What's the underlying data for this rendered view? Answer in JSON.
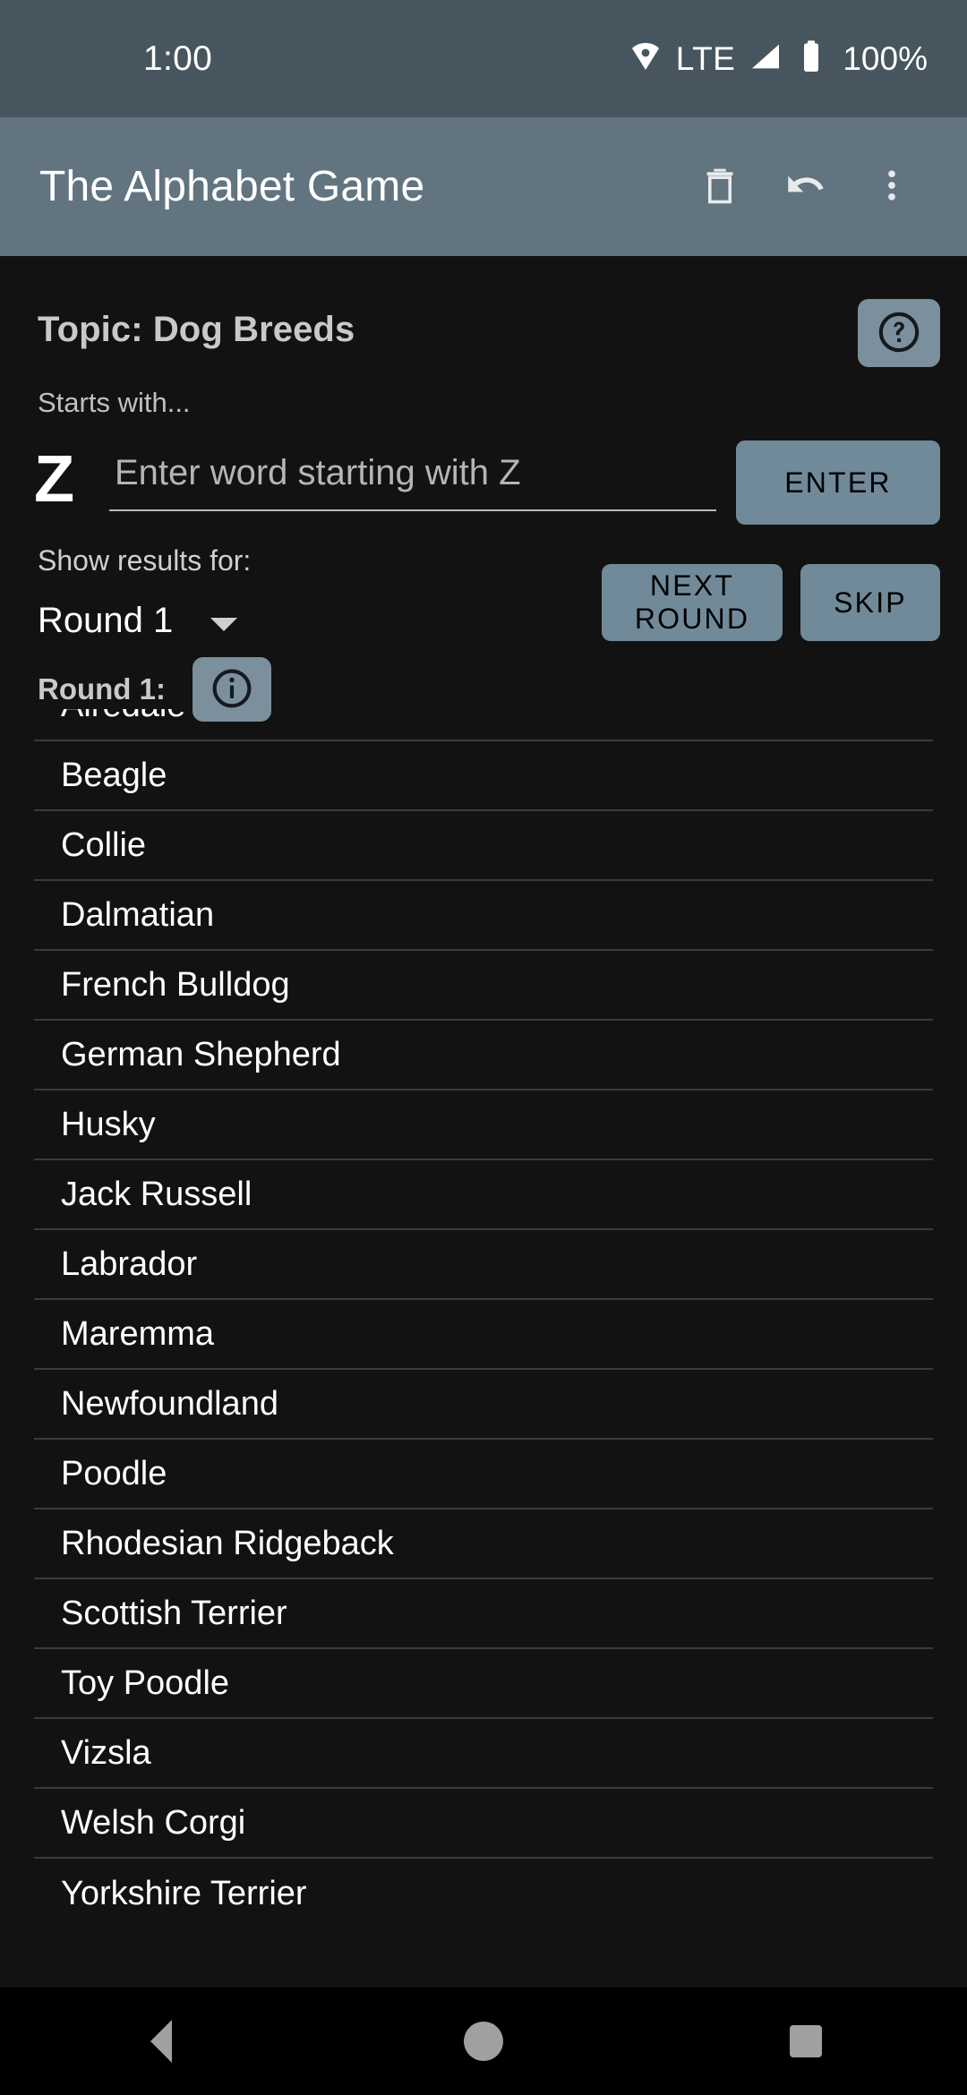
{
  "status_bar": {
    "time": "1:00",
    "network_type": "LTE",
    "battery_percent": "100%",
    "icons": [
      "wifi-icon",
      "signal-icon",
      "battery-icon"
    ]
  },
  "app_bar": {
    "title": "The Alphabet Game",
    "actions": [
      {
        "name": "delete-button",
        "icon": "trash-icon"
      },
      {
        "name": "undo-button",
        "icon": "undo-icon"
      },
      {
        "name": "overflow-menu-button",
        "icon": "more-vert-icon"
      }
    ]
  },
  "main": {
    "topic_title": "Topic: Dog Breeds",
    "help_icon": "help-circle-icon",
    "starts_with_label": "Starts with...",
    "current_letter": "Z",
    "word_input_value": "",
    "word_input_placeholder": "Enter word starting with Z",
    "enter_button": "ENTER",
    "show_results_label": "Show results for:",
    "round_selector_value": "Round 1",
    "round_selector_options": [
      "Round 1"
    ],
    "next_round_button": "NEXT ROUND",
    "skip_button": "SKIP",
    "round_header": "Round 1:",
    "info_icon": "info-circle-icon",
    "results": [
      "Airedale",
      "Beagle",
      "Collie",
      "Dalmatian",
      "French Bulldog",
      "German Shepherd",
      "Husky",
      "Jack Russell",
      "Labrador",
      "Maremma",
      "Newfoundland",
      "Poodle",
      "Rhodesian Ridgeback",
      "Scottish Terrier",
      "Toy Poodle",
      "Vizsla",
      "Welsh Corgi",
      "Yorkshire Terrier"
    ]
  },
  "nav_bar": {
    "buttons": [
      {
        "name": "nav-back-button",
        "icon": "triangle-back-icon"
      },
      {
        "name": "nav-home-button",
        "icon": "circle-home-icon"
      },
      {
        "name": "nav-recents-button",
        "icon": "square-recents-icon"
      }
    ]
  },
  "colors": {
    "status_bar_bg": "#47565e",
    "app_bar_bg": "#617480",
    "content_bg": "#121212",
    "accent_button": "#718a99",
    "accent_icon_button": "#7b909c",
    "divider": "#3b3b3b",
    "nav_bar_bg": "#000000"
  }
}
